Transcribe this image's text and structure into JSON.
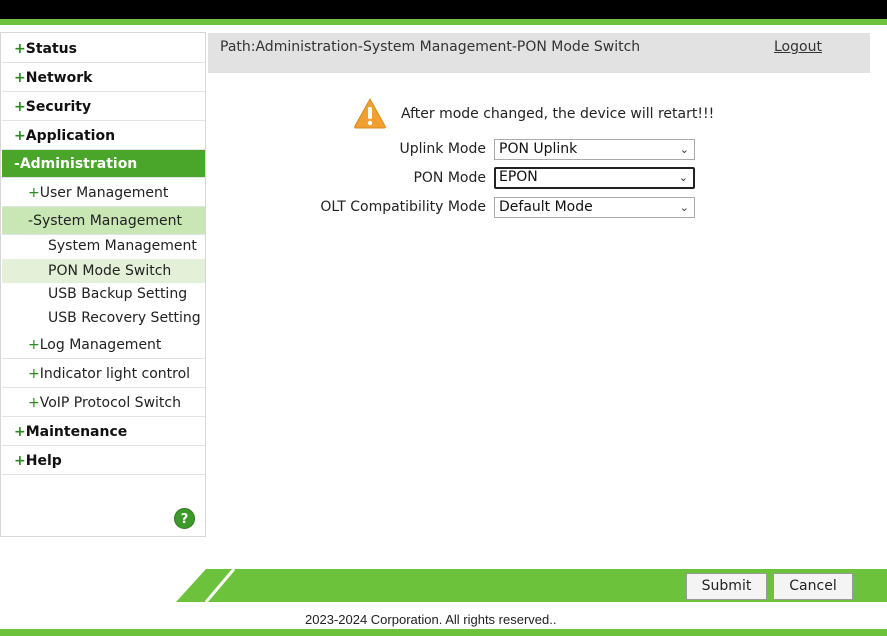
{
  "sidebar": {
    "items": [
      {
        "sign": "+",
        "label": "Status"
      },
      {
        "sign": "+",
        "label": "Network"
      },
      {
        "sign": "+",
        "label": "Security"
      },
      {
        "sign": "+",
        "label": "Application"
      },
      {
        "sign": "-",
        "label": "Administration"
      },
      {
        "sign": "+",
        "label": "User Management"
      },
      {
        "sign": "-",
        "label": "System Management"
      },
      {
        "label": "System Management"
      },
      {
        "label": "PON Mode Switch"
      },
      {
        "label": "USB Backup Setting"
      },
      {
        "label": "USB Recovery Setting"
      },
      {
        "sign": "+",
        "label": "Log Management"
      },
      {
        "sign": "+",
        "label": "Indicator light control"
      },
      {
        "sign": "+",
        "label": "VoIP Protocol Switch"
      },
      {
        "sign": "+",
        "label": "Maintenance"
      },
      {
        "sign": "+",
        "label": "Help"
      }
    ],
    "help_icon": "?"
  },
  "header": {
    "path": "Path:Administration-System Management-PON Mode Switch",
    "logout": "Logout"
  },
  "main": {
    "warning": "After mode changed, the device will retart!!!",
    "uplink_label": "Uplink Mode",
    "uplink_value": "PON Uplink",
    "pon_label": "PON Mode",
    "pon_value": "EPON",
    "olt_label": "OLT Compatibility Mode",
    "olt_value": "Default Mode"
  },
  "footer": {
    "submit": "Submit",
    "cancel": "Cancel",
    "copyright": "2023-2024 Corporation. All rights reserved.."
  },
  "colors": {
    "accent": "#6dc23b",
    "menu_active": "#4aa52b",
    "submenu_active": "#c8e7b4",
    "warning": "#f0a030"
  }
}
